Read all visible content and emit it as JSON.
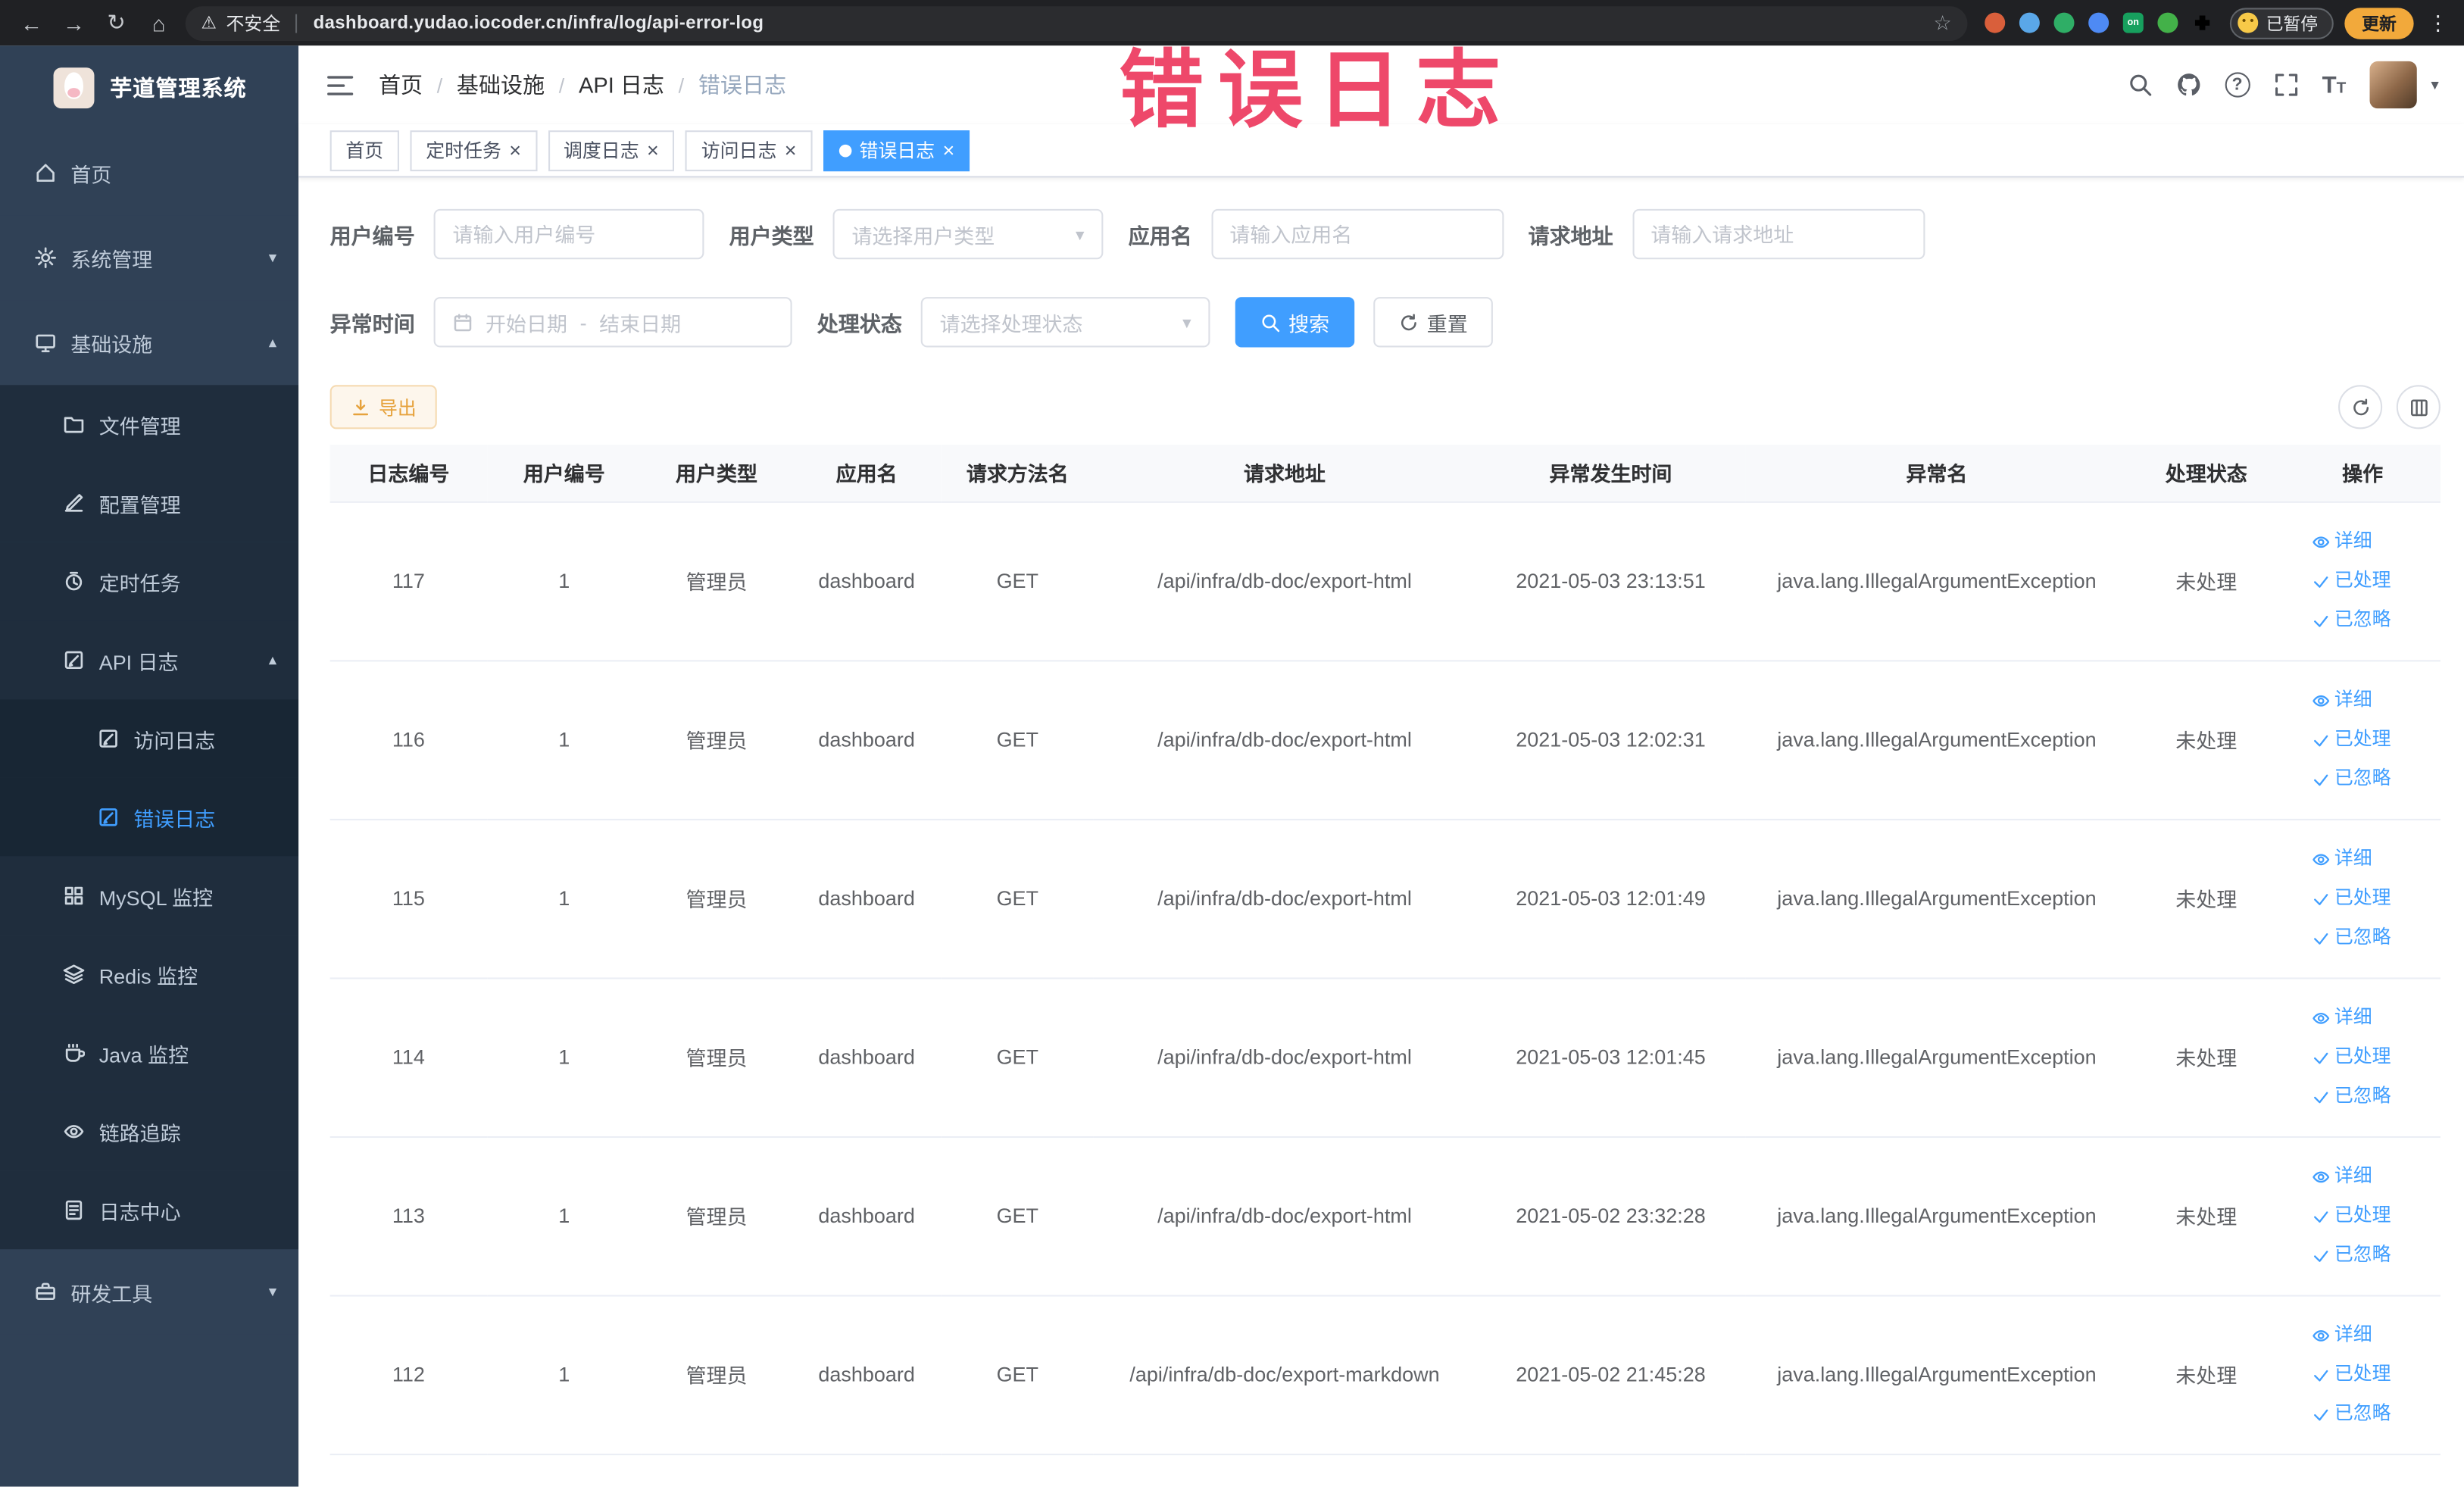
{
  "colors": {
    "accent": "#409EFF",
    "sidebar_bg": "#304156",
    "submenu_bg": "#1f2d3d",
    "warning": "#e6a23c",
    "annotation_red": "#ee3f63",
    "browser_bar_bg": "#202124"
  },
  "icons": {
    "back": "←",
    "forward": "→",
    "reload": "↻",
    "home": "⌂",
    "warning": "⚠",
    "star": "☆",
    "kebab": "⋮",
    "caret_down": "▾",
    "caret_up": "▴",
    "close": "×",
    "question": "?",
    "font_size_big": "T",
    "font_size_small": "T"
  },
  "browser": {
    "security_label": "不安全",
    "url": "dashboard.yudao.iocoder.cn/infra/log/api-error-log",
    "extensions": [
      {
        "key": "ext-orange-circle",
        "color": "#d95f3b",
        "shape": "circle"
      },
      {
        "key": "ext-blue-drop",
        "color": "#5aa7e8",
        "shape": "circle"
      },
      {
        "key": "ext-green-circle",
        "color": "#2fae66",
        "shape": "circle"
      },
      {
        "key": "ext-blue-grid",
        "color": "#4e8af4",
        "shape": "circle"
      },
      {
        "key": "ext-on-badge",
        "color": "#17a05e",
        "shape": "square",
        "label": "on"
      },
      {
        "key": "ext-green-leaf",
        "color": "#43b149",
        "shape": "circle"
      },
      {
        "key": "ext-extensions-puzzle",
        "color": "#c4c7cc",
        "shape": "puzzle"
      }
    ],
    "paused_badge": "已暂停",
    "update_button": "更新"
  },
  "overlay": {
    "text": "错误日志"
  },
  "sidebar": {
    "logo_title": "芋道管理系统",
    "items": [
      {
        "key": "home",
        "label": "首页",
        "level": 1,
        "icon": "home"
      },
      {
        "key": "system",
        "label": "系统管理",
        "level": 1,
        "icon": "gear",
        "chevron": "down"
      },
      {
        "key": "infra",
        "label": "基础设施",
        "level": 1,
        "icon": "monitor",
        "chevron": "up"
      },
      {
        "key": "file",
        "label": "文件管理",
        "level": 2,
        "icon": "folder"
      },
      {
        "key": "config",
        "label": "配置管理",
        "level": 2,
        "icon": "edit"
      },
      {
        "key": "job",
        "label": "定时任务",
        "level": 2,
        "icon": "timer"
      },
      {
        "key": "api-log",
        "label": "API 日志",
        "level": 2,
        "icon": "editdoc",
        "chevron": "up"
      },
      {
        "key": "access-log",
        "label": "访问日志",
        "level": 3,
        "icon": "editdoc"
      },
      {
        "key": "error-log",
        "label": "错误日志",
        "level": 3,
        "icon": "editdoc",
        "active": true
      },
      {
        "key": "mysql",
        "label": "MySQL 监控",
        "level": 2,
        "icon": "grid"
      },
      {
        "key": "redis",
        "label": "Redis 监控",
        "level": 2,
        "icon": "layers"
      },
      {
        "key": "java",
        "label": "Java 监控",
        "level": 2,
        "icon": "coffee"
      },
      {
        "key": "trace",
        "label": "链路追踪",
        "level": 2,
        "icon": "eye"
      },
      {
        "key": "log-center",
        "label": "日志中心",
        "level": 2,
        "icon": "logdoc"
      },
      {
        "key": "dev-tools",
        "label": "研发工具",
        "level": 1,
        "icon": "toolbox",
        "chevron": "down"
      }
    ]
  },
  "navbar": {
    "separator": "/",
    "breadcrumb": [
      {
        "key": "home",
        "label": "首页"
      },
      {
        "key": "infra",
        "label": "基础设施"
      },
      {
        "key": "api-log",
        "label": "API 日志"
      },
      {
        "key": "error-log",
        "label": "错误日志"
      }
    ]
  },
  "tabs": [
    {
      "key": "home",
      "label": "首页",
      "closable": false,
      "active": false
    },
    {
      "key": "job",
      "label": "定时任务",
      "closable": true,
      "active": false
    },
    {
      "key": "job-log",
      "label": "调度日志",
      "closable": true,
      "active": false
    },
    {
      "key": "access-log",
      "label": "访问日志",
      "closable": true,
      "active": false
    },
    {
      "key": "error-log",
      "label": "错误日志",
      "closable": true,
      "active": true
    }
  ],
  "filters": {
    "user_id_label": "用户编号",
    "user_id_placeholder": "请输入用户编号",
    "user_type_label": "用户类型",
    "user_type_placeholder": "请选择用户类型",
    "app_name_label": "应用名",
    "app_name_placeholder": "请输入应用名",
    "request_url_label": "请求地址",
    "request_url_placeholder": "请输入请求地址",
    "exception_time_label": "异常时间",
    "date_start_placeholder": "开始日期",
    "date_separator": "-",
    "date_end_placeholder": "结束日期",
    "process_status_label": "处理状态",
    "process_status_placeholder": "请选择处理状态",
    "search_button": "搜索",
    "reset_button": "重置"
  },
  "toolbar": {
    "export_button": "导出"
  },
  "table": {
    "headers": [
      "日志编号",
      "用户编号",
      "用户类型",
      "应用名",
      "请求方法名",
      "请求地址",
      "异常发生时间",
      "异常名",
      "处理状态",
      "操作"
    ],
    "actions": {
      "detail": "详细",
      "processed": "已处理",
      "ignored": "已忽略"
    },
    "rows": [
      {
        "id": "117",
        "user_id": "1",
        "user_type": "管理员",
        "app": "dashboard",
        "method": "GET",
        "url": "/api/infra/db-doc/export-html",
        "time": "2021-05-03 23:13:51",
        "exception": "java.lang.IllegalArgumentException",
        "status": "未处理"
      },
      {
        "id": "116",
        "user_id": "1",
        "user_type": "管理员",
        "app": "dashboard",
        "method": "GET",
        "url": "/api/infra/db-doc/export-html",
        "time": "2021-05-03 12:02:31",
        "exception": "java.lang.IllegalArgumentException",
        "status": "未处理"
      },
      {
        "id": "115",
        "user_id": "1",
        "user_type": "管理员",
        "app": "dashboard",
        "method": "GET",
        "url": "/api/infra/db-doc/export-html",
        "time": "2021-05-03 12:01:49",
        "exception": "java.lang.IllegalArgumentException",
        "status": "未处理"
      },
      {
        "id": "114",
        "user_id": "1",
        "user_type": "管理员",
        "app": "dashboard",
        "method": "GET",
        "url": "/api/infra/db-doc/export-html",
        "time": "2021-05-03 12:01:45",
        "exception": "java.lang.IllegalArgumentException",
        "status": "未处理"
      },
      {
        "id": "113",
        "user_id": "1",
        "user_type": "管理员",
        "app": "dashboard",
        "method": "GET",
        "url": "/api/infra/db-doc/export-html",
        "time": "2021-05-02 23:32:28",
        "exception": "java.lang.IllegalArgumentException",
        "status": "未处理"
      },
      {
        "id": "112",
        "user_id": "1",
        "user_type": "管理员",
        "app": "dashboard",
        "method": "GET",
        "url": "/api/infra/db-doc/export-markdown",
        "time": "2021-05-02 21:45:28",
        "exception": "java.lang.IllegalArgumentException",
        "status": "未处理"
      }
    ]
  }
}
